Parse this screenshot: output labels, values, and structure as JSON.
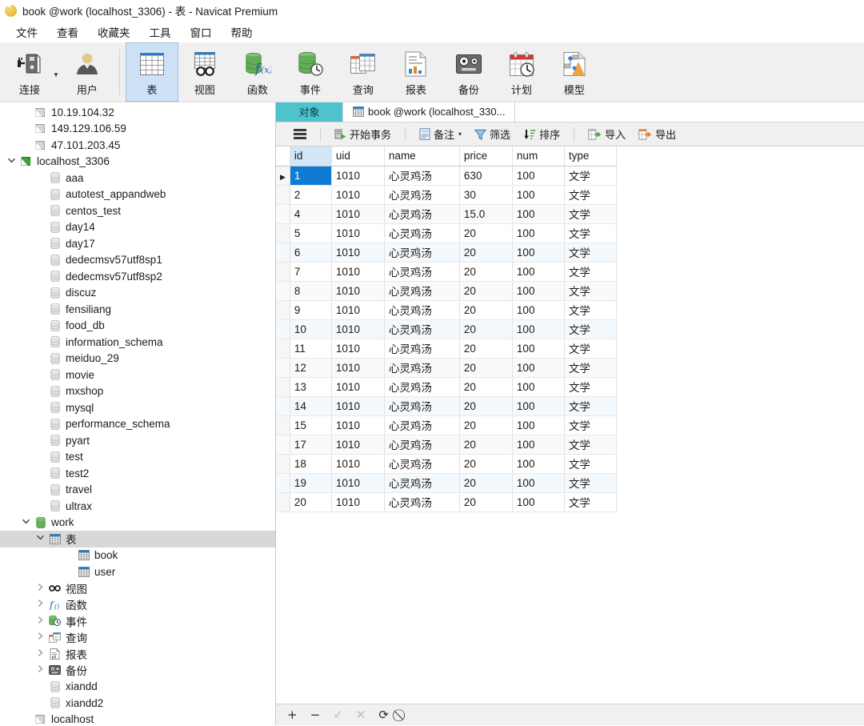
{
  "window": {
    "title": "book @work (localhost_3306) - 表 - Navicat Premium",
    "logo_icon": "navicat-logo-icon"
  },
  "menubar": {
    "items": [
      {
        "label": "文件",
        "name": "menu-file"
      },
      {
        "label": "查看",
        "name": "menu-view"
      },
      {
        "label": "收藏夹",
        "name": "menu-favorites"
      },
      {
        "label": "工具",
        "name": "menu-tools"
      },
      {
        "label": "窗口",
        "name": "menu-window"
      },
      {
        "label": "帮助",
        "name": "menu-help"
      }
    ]
  },
  "ribbon": {
    "buttons": [
      {
        "label": "连接",
        "icon": "connection-icon",
        "active": false
      },
      {
        "label": "用户",
        "icon": "user-icon",
        "active": false
      },
      {
        "label": "表",
        "icon": "table-icon",
        "active": true
      },
      {
        "label": "视图",
        "icon": "view-icon",
        "active": false
      },
      {
        "label": "函数",
        "icon": "function-icon",
        "active": false
      },
      {
        "label": "事件",
        "icon": "event-icon",
        "active": false
      },
      {
        "label": "查询",
        "icon": "query-icon",
        "active": false
      },
      {
        "label": "报表",
        "icon": "report-icon",
        "active": false
      },
      {
        "label": "备份",
        "icon": "backup-icon",
        "active": false
      },
      {
        "label": "计划",
        "icon": "schedule-icon",
        "active": false
      },
      {
        "label": "模型",
        "icon": "model-icon",
        "active": false
      }
    ]
  },
  "sidebar": {
    "items": [
      {
        "label": "10.19.104.32",
        "icon": "connection-gray-icon",
        "indent": 1,
        "twisty": "",
        "selected": false
      },
      {
        "label": "149.129.106.59",
        "icon": "connection-gray-icon",
        "indent": 1,
        "twisty": "",
        "selected": false
      },
      {
        "label": "47.101.203.45",
        "icon": "connection-gray-icon",
        "indent": 1,
        "twisty": "",
        "selected": false
      },
      {
        "label": "localhost_3306",
        "icon": "connection-green-icon",
        "indent": 0,
        "twisty": "v",
        "selected": false
      },
      {
        "label": "aaa",
        "icon": "database-gray-icon",
        "indent": 2,
        "twisty": "",
        "selected": false
      },
      {
        "label": "autotest_appandweb",
        "icon": "database-gray-icon",
        "indent": 2,
        "twisty": "",
        "selected": false
      },
      {
        "label": "centos_test",
        "icon": "database-gray-icon",
        "indent": 2,
        "twisty": "",
        "selected": false
      },
      {
        "label": "day14",
        "icon": "database-gray-icon",
        "indent": 2,
        "twisty": "",
        "selected": false
      },
      {
        "label": "day17",
        "icon": "database-gray-icon",
        "indent": 2,
        "twisty": "",
        "selected": false
      },
      {
        "label": "dedecmsv57utf8sp1",
        "icon": "database-gray-icon",
        "indent": 2,
        "twisty": "",
        "selected": false
      },
      {
        "label": "dedecmsv57utf8sp2",
        "icon": "database-gray-icon",
        "indent": 2,
        "twisty": "",
        "selected": false
      },
      {
        "label": "discuz",
        "icon": "database-gray-icon",
        "indent": 2,
        "twisty": "",
        "selected": false
      },
      {
        "label": "fensiliang",
        "icon": "database-gray-icon",
        "indent": 2,
        "twisty": "",
        "selected": false
      },
      {
        "label": "food_db",
        "icon": "database-gray-icon",
        "indent": 2,
        "twisty": "",
        "selected": false
      },
      {
        "label": "information_schema",
        "icon": "database-gray-icon",
        "indent": 2,
        "twisty": "",
        "selected": false
      },
      {
        "label": "meiduo_29",
        "icon": "database-gray-icon",
        "indent": 2,
        "twisty": "",
        "selected": false
      },
      {
        "label": "movie",
        "icon": "database-gray-icon",
        "indent": 2,
        "twisty": "",
        "selected": false
      },
      {
        "label": "mxshop",
        "icon": "database-gray-icon",
        "indent": 2,
        "twisty": "",
        "selected": false
      },
      {
        "label": "mysql",
        "icon": "database-gray-icon",
        "indent": 2,
        "twisty": "",
        "selected": false
      },
      {
        "label": "performance_schema",
        "icon": "database-gray-icon",
        "indent": 2,
        "twisty": "",
        "selected": false
      },
      {
        "label": "pyart",
        "icon": "database-gray-icon",
        "indent": 2,
        "twisty": "",
        "selected": false
      },
      {
        "label": "test",
        "icon": "database-gray-icon",
        "indent": 2,
        "twisty": "",
        "selected": false
      },
      {
        "label": "test2",
        "icon": "database-gray-icon",
        "indent": 2,
        "twisty": "",
        "selected": false
      },
      {
        "label": "travel",
        "icon": "database-gray-icon",
        "indent": 2,
        "twisty": "",
        "selected": false
      },
      {
        "label": "ultrax",
        "icon": "database-gray-icon",
        "indent": 2,
        "twisty": "",
        "selected": false
      },
      {
        "label": "work",
        "icon": "database-green-icon",
        "indent": 1,
        "twisty": "v",
        "selected": false
      },
      {
        "label": "表",
        "icon": "table-folder-icon",
        "indent": 2,
        "twisty": "v",
        "selected": true
      },
      {
        "label": "book",
        "icon": "table-item-icon",
        "indent": 4,
        "twisty": "",
        "selected": false
      },
      {
        "label": "user",
        "icon": "table-item-icon",
        "indent": 4,
        "twisty": "",
        "selected": false
      },
      {
        "label": "视图",
        "icon": "view-folder-icon",
        "indent": 2,
        "twisty": ">",
        "selected": false
      },
      {
        "label": "函数",
        "icon": "function-folder-icon",
        "indent": 2,
        "twisty": ">",
        "selected": false
      },
      {
        "label": "事件",
        "icon": "event-folder-icon",
        "indent": 2,
        "twisty": ">",
        "selected": false
      },
      {
        "label": "查询",
        "icon": "query-folder-icon",
        "indent": 2,
        "twisty": ">",
        "selected": false
      },
      {
        "label": "报表",
        "icon": "report-folder-icon",
        "indent": 2,
        "twisty": ">",
        "selected": false
      },
      {
        "label": "备份",
        "icon": "backup-folder-icon",
        "indent": 2,
        "twisty": ">",
        "selected": false
      },
      {
        "label": "xiandd",
        "icon": "database-gray-icon",
        "indent": 2,
        "twisty": "",
        "selected": false
      },
      {
        "label": "xiandd2",
        "icon": "database-gray-icon",
        "indent": 2,
        "twisty": "",
        "selected": false
      },
      {
        "label": "localhost",
        "icon": "connection-gray-icon",
        "indent": 1,
        "twisty": "",
        "selected": false
      }
    ]
  },
  "tabs": [
    {
      "label": "对象",
      "icon": "",
      "style": "teal",
      "active": true
    },
    {
      "label": "book @work (localhost_330...",
      "icon": "table-item-icon",
      "style": "doc",
      "active": false
    }
  ],
  "action_toolbar": {
    "menu_icon": "hamburger-icon",
    "buttons": [
      {
        "label": "开始事务",
        "icon": "begin-transaction-icon",
        "caret": false
      },
      {
        "label": "备注",
        "icon": "note-icon",
        "caret": true
      },
      {
        "label": "筛选",
        "icon": "filter-icon",
        "caret": false
      },
      {
        "label": "排序",
        "icon": "sort-icon",
        "caret": false
      },
      {
        "label": "导入",
        "icon": "import-icon",
        "caret": false
      },
      {
        "label": "导出",
        "icon": "export-icon",
        "caret": false
      }
    ]
  },
  "grid": {
    "columns": [
      {
        "key": "id",
        "label": "id",
        "cls": "c-id",
        "highlight": true
      },
      {
        "key": "uid",
        "label": "uid",
        "cls": "c-uid",
        "highlight": false
      },
      {
        "key": "name",
        "label": "name",
        "cls": "c-name",
        "highlight": false
      },
      {
        "key": "price",
        "label": "price",
        "cls": "c-price",
        "highlight": false
      },
      {
        "key": "num",
        "label": "num",
        "cls": "c-num",
        "highlight": false
      },
      {
        "key": "type",
        "label": "type",
        "cls": "c-type",
        "highlight": false
      }
    ],
    "current_row_marker": "▶",
    "rows": [
      {
        "id": "1",
        "uid": "1010",
        "name": "心灵鸡汤",
        "price": "630",
        "num": "100",
        "type": "文学",
        "current": true
      },
      {
        "id": "2",
        "uid": "1010",
        "name": "心灵鸡汤",
        "price": "30",
        "num": "100",
        "type": "文学",
        "current": false
      },
      {
        "id": "4",
        "uid": "1010",
        "name": "心灵鸡汤",
        "price": "15.0",
        "num": "100",
        "type": "文学",
        "current": false
      },
      {
        "id": "5",
        "uid": "1010",
        "name": "心灵鸡汤",
        "price": "20",
        "num": "100",
        "type": "文学",
        "current": false
      },
      {
        "id": "6",
        "uid": "1010",
        "name": "心灵鸡汤",
        "price": "20",
        "num": "100",
        "type": "文学",
        "current": false
      },
      {
        "id": "7",
        "uid": "1010",
        "name": "心灵鸡汤",
        "price": "20",
        "num": "100",
        "type": "文学",
        "current": false
      },
      {
        "id": "8",
        "uid": "1010",
        "name": "心灵鸡汤",
        "price": "20",
        "num": "100",
        "type": "文学",
        "current": false
      },
      {
        "id": "9",
        "uid": "1010",
        "name": "心灵鸡汤",
        "price": "20",
        "num": "100",
        "type": "文学",
        "current": false
      },
      {
        "id": "10",
        "uid": "1010",
        "name": "心灵鸡汤",
        "price": "20",
        "num": "100",
        "type": "文学",
        "current": false
      },
      {
        "id": "11",
        "uid": "1010",
        "name": "心灵鸡汤",
        "price": "20",
        "num": "100",
        "type": "文学",
        "current": false
      },
      {
        "id": "12",
        "uid": "1010",
        "name": "心灵鸡汤",
        "price": "20",
        "num": "100",
        "type": "文学",
        "current": false
      },
      {
        "id": "13",
        "uid": "1010",
        "name": "心灵鸡汤",
        "price": "20",
        "num": "100",
        "type": "文学",
        "current": false
      },
      {
        "id": "14",
        "uid": "1010",
        "name": "心灵鸡汤",
        "price": "20",
        "num": "100",
        "type": "文学",
        "current": false
      },
      {
        "id": "15",
        "uid": "1010",
        "name": "心灵鸡汤",
        "price": "20",
        "num": "100",
        "type": "文学",
        "current": false
      },
      {
        "id": "17",
        "uid": "1010",
        "name": "心灵鸡汤",
        "price": "20",
        "num": "100",
        "type": "文学",
        "current": false
      },
      {
        "id": "18",
        "uid": "1010",
        "name": "心灵鸡汤",
        "price": "20",
        "num": "100",
        "type": "文学",
        "current": false
      },
      {
        "id": "19",
        "uid": "1010",
        "name": "心灵鸡汤",
        "price": "20",
        "num": "100",
        "type": "文学",
        "current": false
      },
      {
        "id": "20",
        "uid": "1010",
        "name": "心灵鸡汤",
        "price": "20",
        "num": "100",
        "type": "文学",
        "current": false
      }
    ]
  },
  "bottom_bar": {
    "buttons": [
      {
        "glyph": "+",
        "name": "add-record-button",
        "disabled": false
      },
      {
        "glyph": "−",
        "name": "delete-record-button",
        "disabled": false
      },
      {
        "glyph": "✓",
        "name": "apply-change-button",
        "disabled": true
      },
      {
        "glyph": "✕",
        "name": "discard-change-button",
        "disabled": true
      },
      {
        "glyph": "⟳",
        "name": "refresh-button",
        "disabled": false
      },
      {
        "glyph": "⃠",
        "name": "stop-button",
        "disabled": false
      }
    ]
  },
  "colors": {
    "accent_selection": "#0f7bd4",
    "tab_teal": "#4ec3cd",
    "ribbon_active": "#cde2f6",
    "tree_selected": "#d8d8d8"
  }
}
